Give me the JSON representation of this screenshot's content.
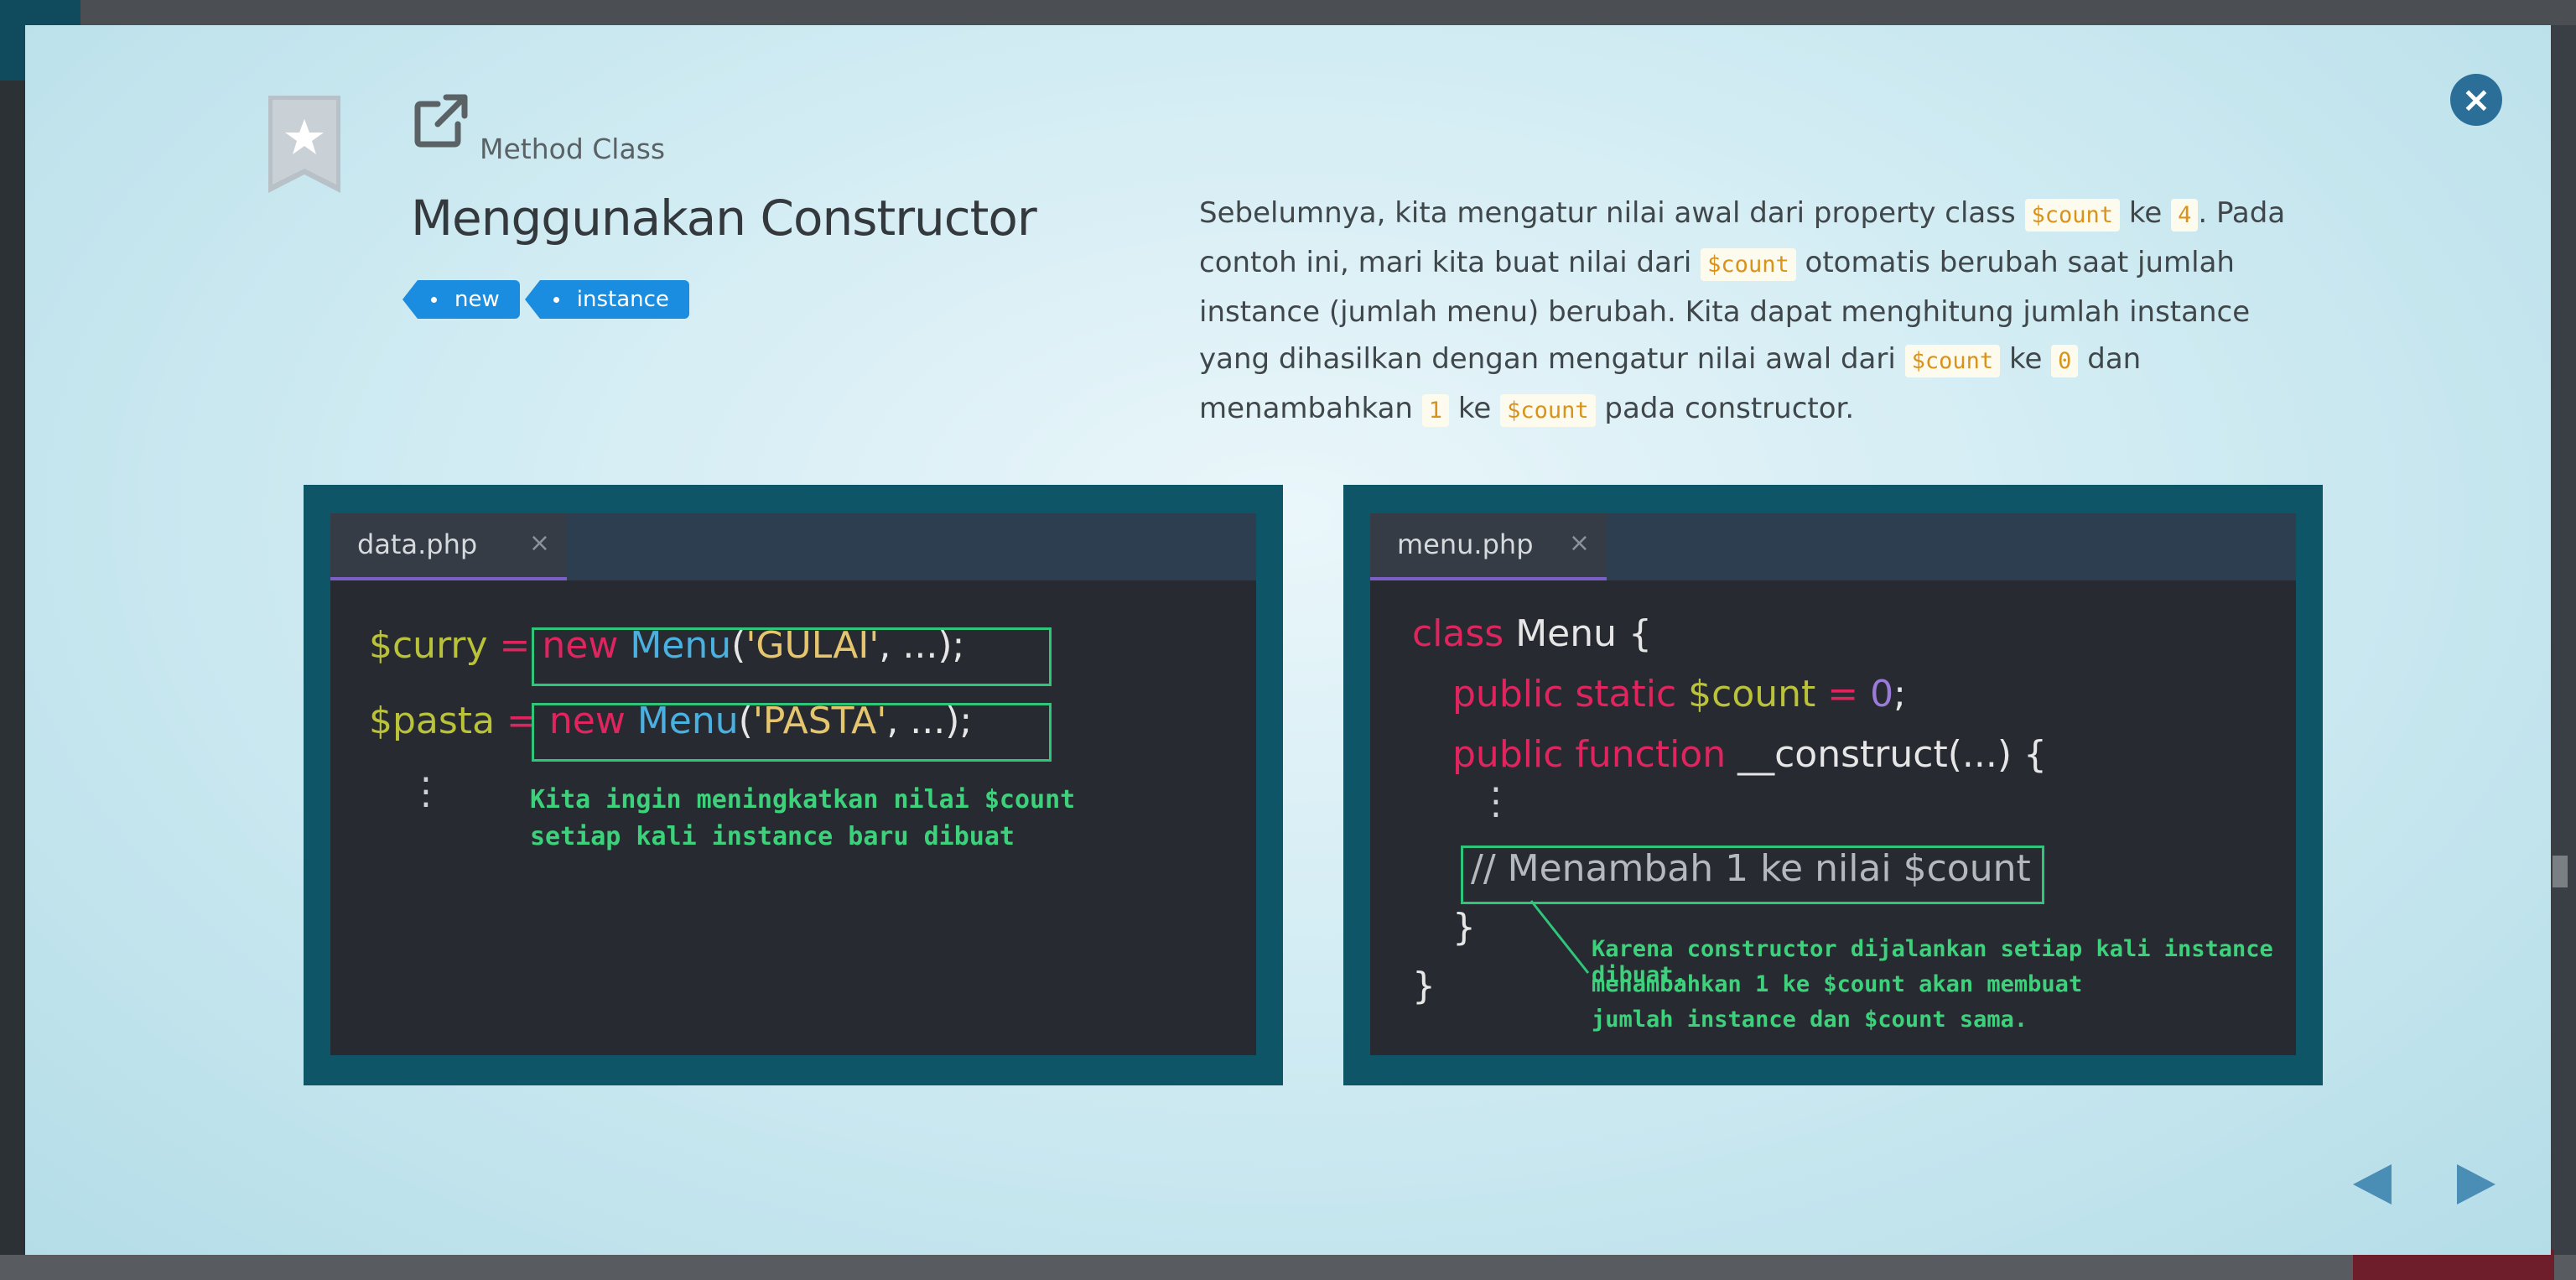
{
  "header": {
    "section": "Method Class",
    "title": "Menggunakan Constructor",
    "tags": [
      "new",
      "instance"
    ],
    "close_icon": "×"
  },
  "description": {
    "p1": "Sebelumnya, kita mengatur nilai awal dari property class ",
    "c1": "$count",
    "p2": " ke ",
    "c2": "4",
    "p3": ". Pada contoh ini, mari kita buat nilai dari ",
    "c3": "$count",
    "p4": " otomatis berubah saat jumlah instance (jumlah menu) berubah. Kita dapat menghitung jumlah instance yang dihasilkan dengan mengatur nilai awal dari ",
    "c4": "$count",
    "p5": " ke ",
    "c5": "0",
    "p6": " dan menambahkan ",
    "c6": "1",
    "p7": " ke ",
    "c7": "$count",
    "p8": " pada constructor."
  },
  "left_panel": {
    "tab": "data.php",
    "tab_close": "×",
    "line1": {
      "var": "$curry",
      "eq": " = ",
      "kw": "new",
      "cls": "Menu",
      "open": "(",
      "str": "'GULAI'",
      "rest": ", ...);"
    },
    "line2": {
      "var": "$pasta",
      "eq": " = ",
      "kw": "new",
      "cls": "Menu",
      "open": "(",
      "str": "'PASTA'",
      "rest": ", ...);"
    },
    "ellipsis": "⋮",
    "note1": "Kita ingin meningkatkan nilai $count",
    "note2": "setiap kali instance baru dibuat"
  },
  "right_panel": {
    "tab": "menu.php",
    "tab_close": "×",
    "l1_kw": "class",
    "l1_rest": " Menu {",
    "l2_kw": "public static",
    "l2_var": " $count",
    "l2_eq": " = ",
    "l2_num": "0",
    "l2_end": ";",
    "l3_kw": "public function",
    "l3_rest": " __construct(...) {",
    "ellipsis": "⋮",
    "comment": "// Menambah 1 ke nilai $count",
    "close_inner": "}",
    "close_outer": "}",
    "note1": "Karena constructor dijalankan setiap kali instance dibuat,",
    "note2": "menambahkan 1 ke $count akan membuat",
    "note3": "jumlah instance dan $count sama."
  },
  "icons": {
    "bookmark": "bookmark-star-icon",
    "external": "external-link-icon",
    "close": "close-icon",
    "prev": "arrow-left-icon",
    "next": "arrow-right-icon"
  },
  "colors": {
    "tag": "#1a8de0",
    "panel": "#0e5568",
    "editor": "#272b31",
    "note": "#3ed17b",
    "keyword": "#e0245e"
  }
}
